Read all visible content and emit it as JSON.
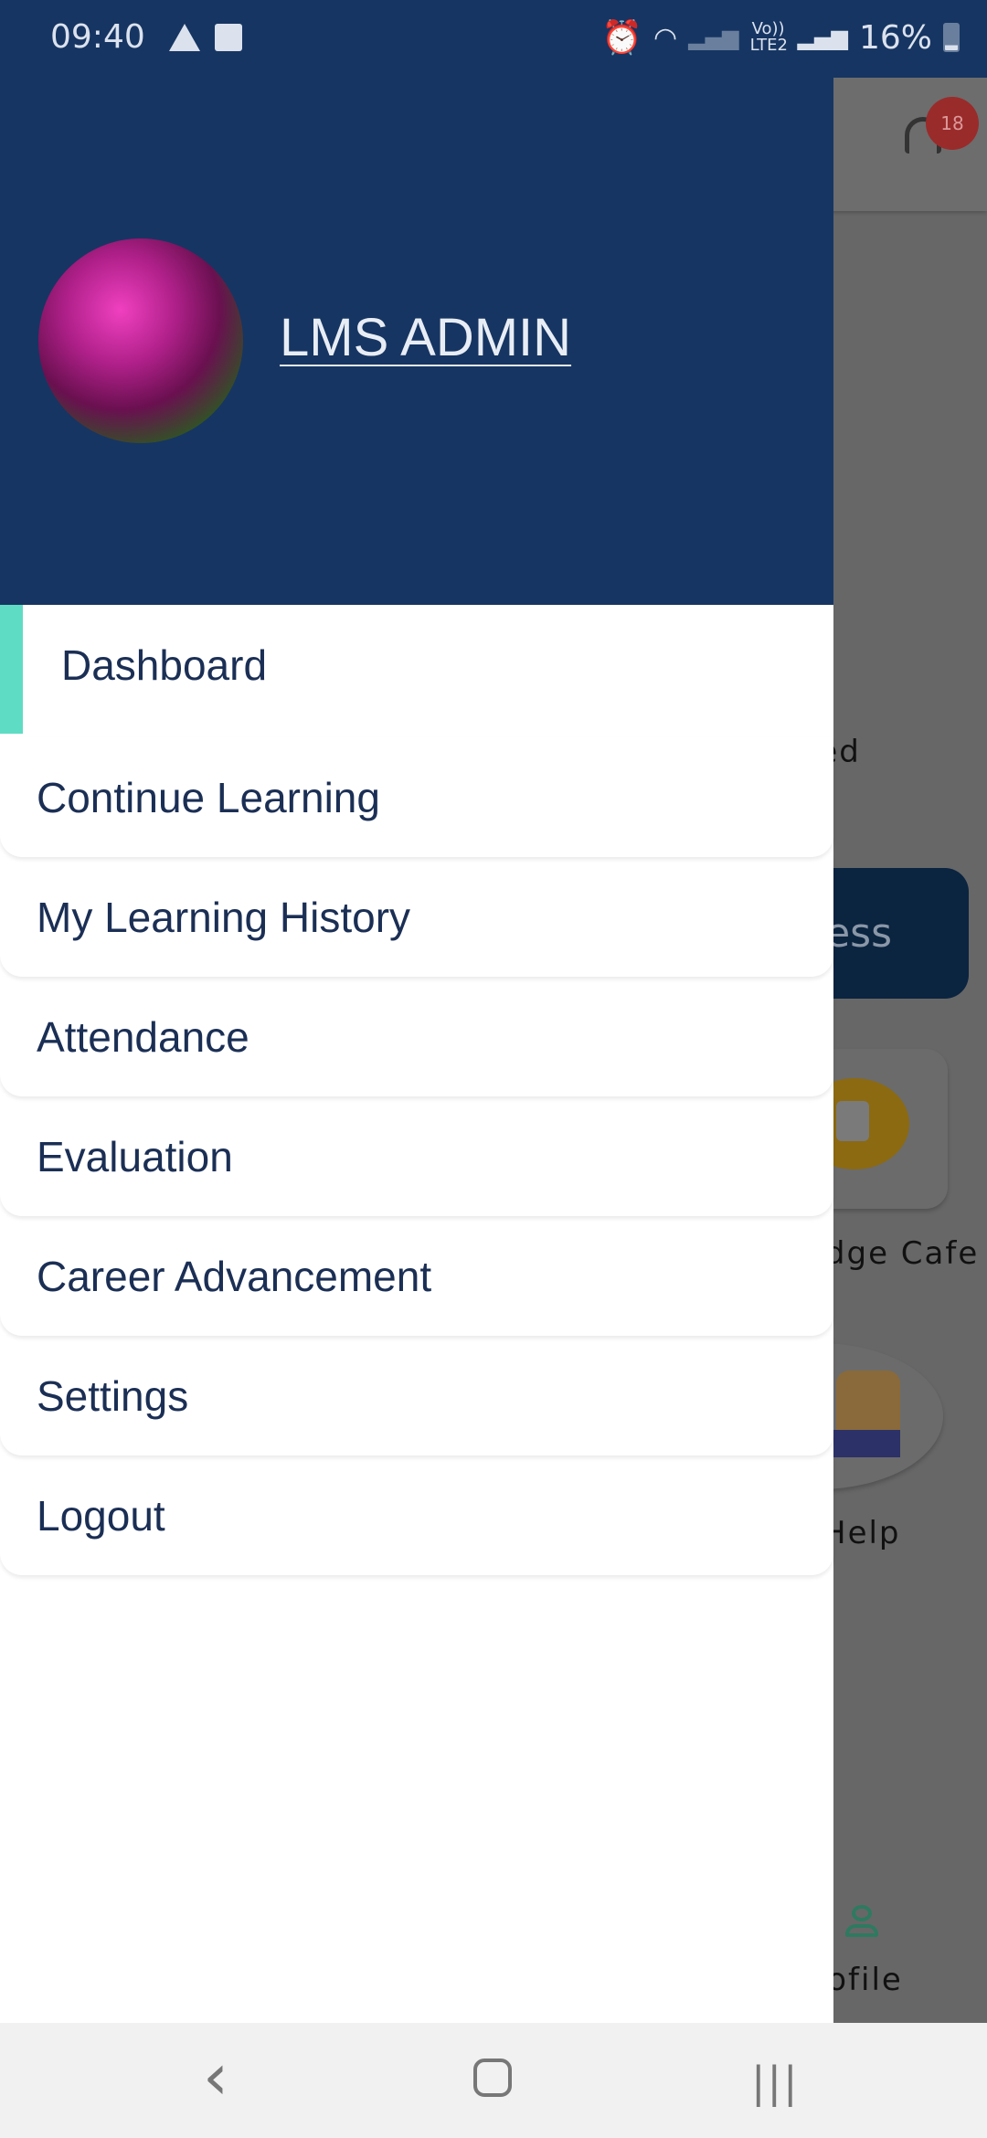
{
  "status_bar": {
    "time": "09:40",
    "network": "Vo)) LTE2",
    "battery": "16%",
    "icons": [
      "warning-icon",
      "image-icon",
      "alarm-icon",
      "wifi-icon",
      "signal-icon",
      "signal-icon",
      "battery-icon"
    ]
  },
  "background": {
    "notification_count": "18",
    "text_fragment_1": "ted",
    "button_fragment": "ress",
    "card_label_fragment": "edge Cafe",
    "help_label": "Help",
    "profile_label": "rofile"
  },
  "drawer": {
    "user_name": "LMS ADMIN",
    "accent_color": "#5fdcc4",
    "header_color": "#163562",
    "items": [
      {
        "label": "Dashboard",
        "active": true
      },
      {
        "label": "Continue Learning"
      },
      {
        "label": "My Learning History"
      },
      {
        "label": "Attendance"
      },
      {
        "label": "Evaluation"
      },
      {
        "label": "Career Advancement"
      },
      {
        "label": "Settings"
      },
      {
        "label": "Logout"
      }
    ]
  },
  "nav_bar": {
    "back": "‹",
    "recents": "|||"
  }
}
